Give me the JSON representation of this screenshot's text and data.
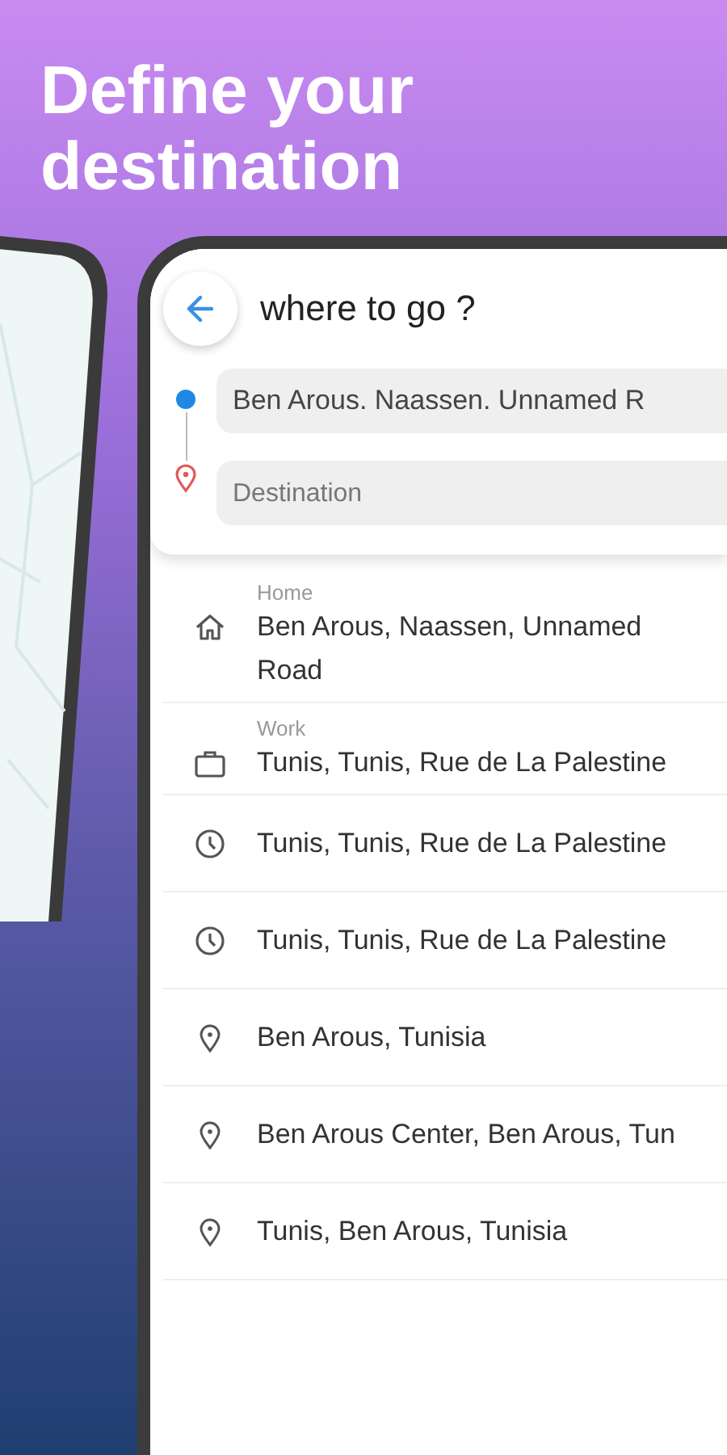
{
  "headline": "Define your destination",
  "screen": {
    "title": "where to go ?",
    "route": {
      "origin": {
        "value": "Ben Arous. Naassen. Unnamed R"
      },
      "destination": {
        "placeholder": "Destination"
      }
    },
    "places": [
      {
        "kind": "home",
        "label": "Home",
        "address": "Ben Arous, Naassen, Unnamed Road"
      },
      {
        "kind": "work",
        "label": "Work",
        "address": "Tunis, Tunis, Rue de La Palestine"
      },
      {
        "kind": "recent",
        "address": "Tunis, Tunis, Rue de La Palestine"
      },
      {
        "kind": "recent",
        "address": "Tunis, Tunis, Rue de La Palestine"
      },
      {
        "kind": "place",
        "address": "Ben Arous, Tunisia"
      },
      {
        "kind": "place",
        "address": "Ben Arous Center, Ben Arous, Tun"
      },
      {
        "kind": "place",
        "address": "Tunis, Ben Arous, Tunisia"
      }
    ]
  }
}
